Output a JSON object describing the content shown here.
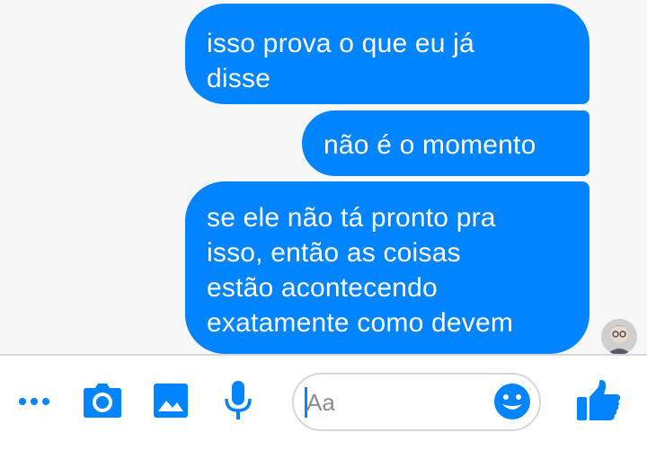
{
  "messages": [
    {
      "sender": "me",
      "lines": [
        "isso prova o que eu já",
        "disse"
      ]
    },
    {
      "sender": "me",
      "lines": [
        "não é o momento"
      ]
    },
    {
      "sender": "me",
      "lines": [
        "se ele não tá pronto pra",
        "isso, então as coisas",
        "estão acontecendo",
        "exatamente como devem"
      ]
    }
  ],
  "composer": {
    "placeholder": "Aa",
    "value": ""
  },
  "icons": {
    "more": "more-icon",
    "camera": "camera-icon",
    "photo": "photo-icon",
    "mic": "mic-icon",
    "emoji": "emoji-icon",
    "like": "like-icon"
  },
  "colors": {
    "accent": "#0084ff",
    "bubble_text": "#ffffff",
    "thread_background": "#f7f7f7"
  }
}
